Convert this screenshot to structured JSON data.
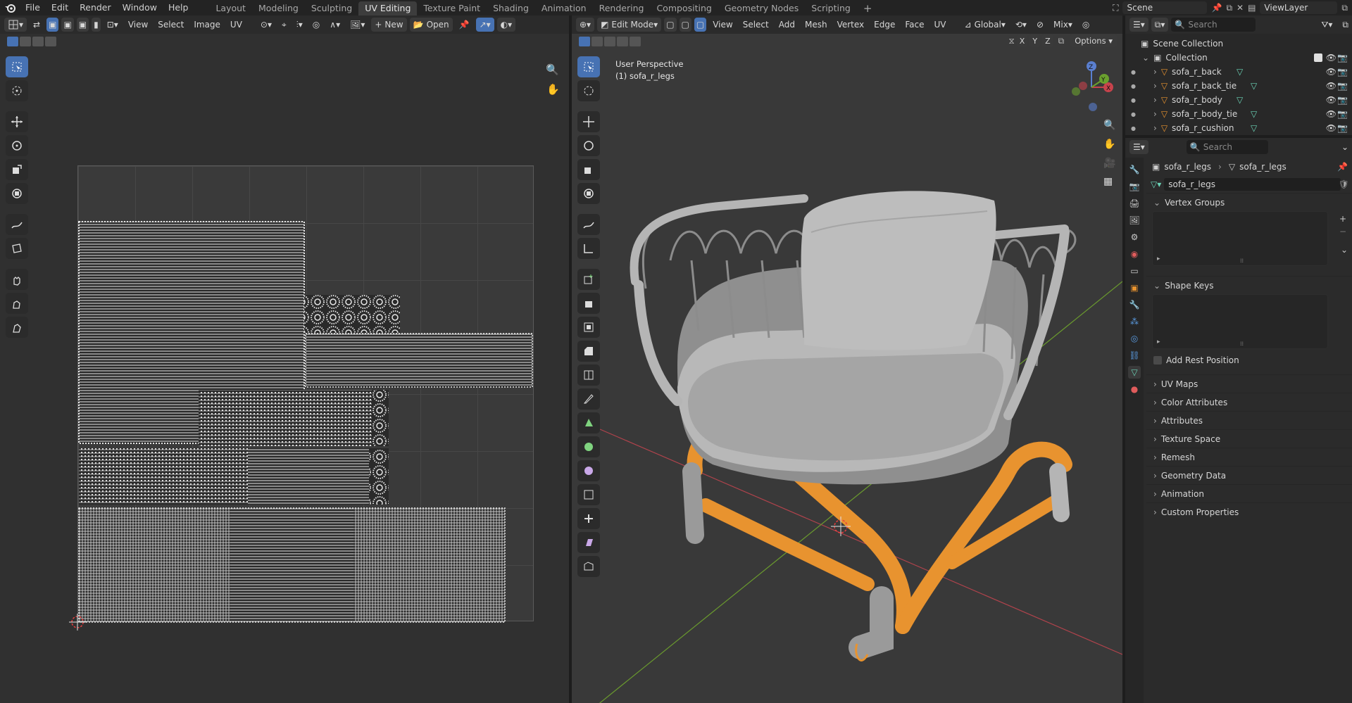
{
  "topbar": {
    "menus": [
      "File",
      "Edit",
      "Render",
      "Window",
      "Help"
    ],
    "workspaces": [
      "Layout",
      "Modeling",
      "Sculpting",
      "UV Editing",
      "Texture Paint",
      "Shading",
      "Animation",
      "Rendering",
      "Compositing",
      "Geometry Nodes",
      "Scripting"
    ],
    "active_workspace": "UV Editing",
    "scene": "Scene",
    "view_layer": "ViewLayer"
  },
  "uv_editor": {
    "menus": [
      "View",
      "Select",
      "Image",
      "UV"
    ],
    "new_label": "New",
    "open_label": "Open"
  },
  "viewport": {
    "mode": "Edit Mode",
    "menus": [
      "View",
      "Select",
      "Add",
      "Mesh",
      "Vertex",
      "Edge",
      "Face",
      "UV"
    ],
    "transform_orientation": "Global",
    "overlay_mix": "Mix",
    "options_label": "Options",
    "axis_x": "X",
    "axis_y": "Y",
    "axis_z": "Z",
    "perspective_label": "User Perspective",
    "object_label": "(1) sofa_r_legs",
    "gizmo_x": "X",
    "gizmo_y": "Y",
    "gizmo_z": "Z"
  },
  "outliner": {
    "search_placeholder": "Search",
    "scene_collection": "Scene Collection",
    "collection": "Collection",
    "objects": [
      "sofa_r_back",
      "sofa_r_back_tie",
      "sofa_r_body",
      "sofa_r_body_tie",
      "sofa_r_cushion"
    ]
  },
  "properties": {
    "search_placeholder": "Search",
    "breadcrumb_object": "sofa_r_legs",
    "breadcrumb_mesh": "sofa_r_legs",
    "mesh_name": "sofa_r_legs",
    "vertex_groups": "Vertex Groups",
    "shape_keys": "Shape Keys",
    "add_rest_position": "Add Rest Position",
    "panels": [
      "UV Maps",
      "Color Attributes",
      "Attributes",
      "Texture Space",
      "Remesh",
      "Geometry Data",
      "Animation",
      "Custom Properties"
    ]
  },
  "colors": {
    "accent": "#4772b3",
    "selection_orange": "#e8932f",
    "header": "#2b2b2b",
    "panel": "#303030"
  }
}
